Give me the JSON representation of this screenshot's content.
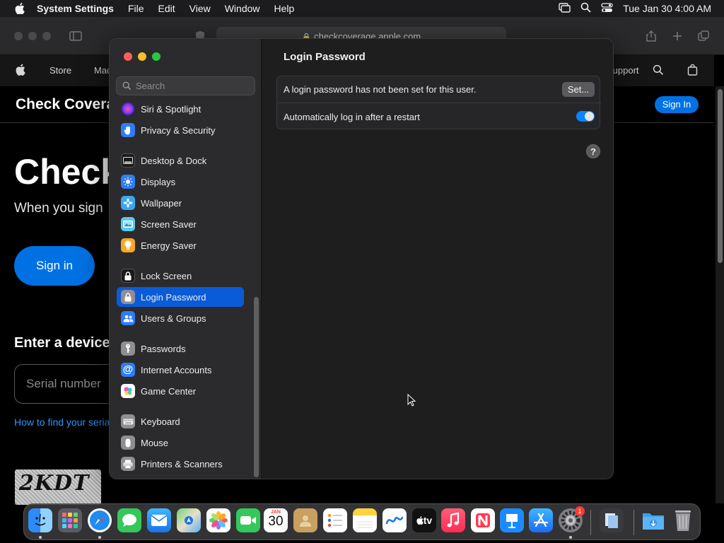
{
  "menubar": {
    "app_name": "System Settings",
    "menus": [
      "File",
      "Edit",
      "View",
      "Window",
      "Help"
    ],
    "clock": "Tue Jan 30  4:00 AM"
  },
  "safari": {
    "url": "checkcoverage.apple.com",
    "nav_items": [
      "Store",
      "Mac",
      "Support"
    ],
    "page": {
      "subnav_title": "Check Coverage",
      "signin_small": "Sign In",
      "hero": "Check",
      "hero_sub": "When you sign",
      "signin_big": "Sign in",
      "enter_device": "Enter a device",
      "serial_placeholder": "Serial number",
      "how_link": "How to find your serial",
      "captcha_text": "2KDT"
    }
  },
  "settings": {
    "search_placeholder": "Search",
    "sidebar": [
      {
        "label": "Siri & Spotlight",
        "icon": "siri-icon"
      },
      {
        "label": "Privacy & Security",
        "icon": "hand-icon"
      },
      {
        "label": "Desktop & Dock",
        "icon": "dock-icon"
      },
      {
        "label": "Displays",
        "icon": "sun-icon"
      },
      {
        "label": "Wallpaper",
        "icon": "flower-icon"
      },
      {
        "label": "Screen Saver",
        "icon": "screen-saver-icon"
      },
      {
        "label": "Energy Saver",
        "icon": "bulb-icon"
      },
      {
        "label": "Lock Screen",
        "icon": "lock-icon"
      },
      {
        "label": "Login Password",
        "icon": "lock-icon",
        "active": true
      },
      {
        "label": "Users & Groups",
        "icon": "users-icon"
      },
      {
        "label": "Passwords",
        "icon": "key-icon"
      },
      {
        "label": "Internet Accounts",
        "icon": "at-icon"
      },
      {
        "label": "Game Center",
        "icon": "game-center-icon"
      },
      {
        "label": "Keyboard",
        "icon": "keyboard-icon"
      },
      {
        "label": "Mouse",
        "icon": "mouse-icon"
      },
      {
        "label": "Printers & Scanners",
        "icon": "printer-icon"
      }
    ],
    "content": {
      "title": "Login Password",
      "row1_text": "A login password has not been set for this user.",
      "set_button": "Set...",
      "row2_text": "Automatically log in after a restart",
      "auto_login": true,
      "help": "?"
    }
  },
  "dock": {
    "apps": [
      "Finder",
      "Launchpad",
      "Safari",
      "Messages",
      "Mail",
      "Maps",
      "Photos",
      "FaceTime",
      "Calendar",
      "Contacts",
      "Reminders",
      "Notes",
      "Freeform",
      "TV",
      "Music",
      "News",
      "Keynote",
      "App Store",
      "System Settings",
      "Preview",
      "Downloads",
      "Trash"
    ],
    "calendar_month": "JAN",
    "calendar_day": "30",
    "tv_label": "tv",
    "settings_badge": "1"
  },
  "colors": {
    "accent": "#0a84ff",
    "selection": "#0a5bd8",
    "apple_blue": "#0071e3"
  }
}
